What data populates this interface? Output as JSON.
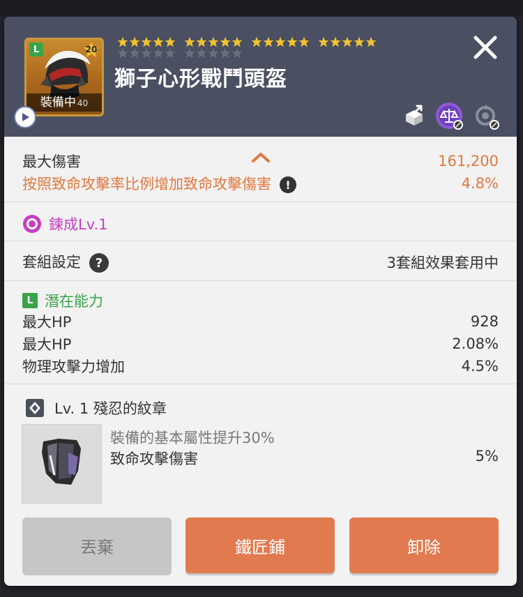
{
  "item": {
    "name": "獅子心形戰鬥頭盔",
    "star_force": "20",
    "equipped_label": "裝備中",
    "equipped_sub": "40",
    "stars_row1_filled": [
      5,
      5,
      5,
      5
    ],
    "stars_row2_filled": [
      0,
      0
    ],
    "tier_badge": "L"
  },
  "header_icons": [
    "play-icon",
    "share-icon",
    "balance-scale-icon",
    "cycle-disabled-icon",
    "close-icon"
  ],
  "stats": [
    {
      "label": "最大傷害",
      "value": "161,200"
    },
    {
      "label": "按照致命攻擊率比例增加致命攻擊傷害",
      "value": "4.8%"
    }
  ],
  "refine": {
    "label": "鍊成Lv.1"
  },
  "set": {
    "label": "套組設定",
    "value": "3套組效果套用中",
    "help": "?"
  },
  "potential": {
    "badge": "L",
    "title": "潛在能力",
    "lines": [
      {
        "label": "最大HP",
        "value": "928"
      },
      {
        "label": "最大HP",
        "value": "2.08%"
      },
      {
        "label": "物理攻擊力增加",
        "value": "4.5%"
      }
    ]
  },
  "emblem": {
    "title": "Lv. 1 殘忍的紋章",
    "desc": "裝備的基本屬性提升30%",
    "stat_label": "致命攻擊傷害",
    "stat_value": "5%"
  },
  "buttons": {
    "discard": "丟棄",
    "smith": "鐵匠鋪",
    "unequip": "卸除"
  },
  "colors": {
    "accent": "#e17a4e",
    "stat_orange": "#e0783f",
    "refine_purple": "#c43fc4",
    "potential_green": "#3aa34a",
    "header_bg": "#4a5062"
  }
}
